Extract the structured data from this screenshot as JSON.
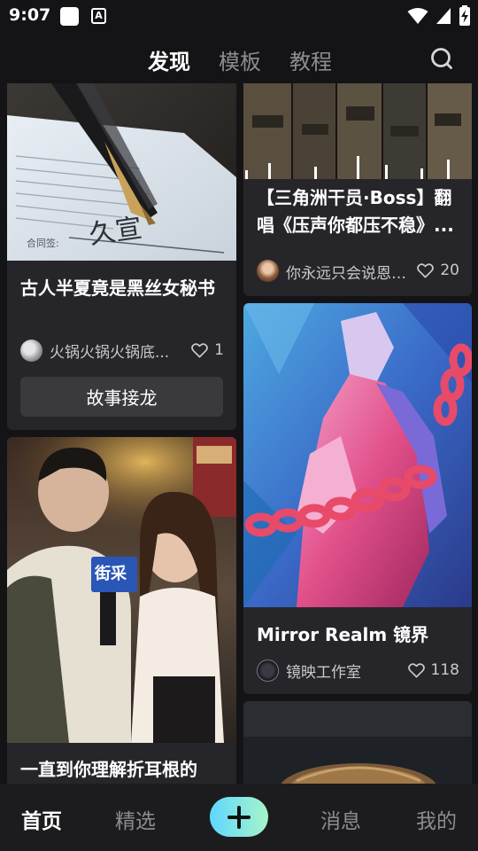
{
  "status_bar": {
    "time": "9:07",
    "a_icon_label": "A"
  },
  "top_tabs": [
    {
      "label": "发现",
      "active": true
    },
    {
      "label": "模板",
      "active": false
    },
    {
      "label": "教程",
      "active": false
    }
  ],
  "cards": {
    "left_1": {
      "title": "古人半夏竟是黑丝女秘书",
      "author": "火锅火锅火锅底...",
      "likes": "1",
      "action_label": "故事接龙",
      "image_text": "久宣",
      "image_caption": "合同签:"
    },
    "left_2": {
      "title": "一直到你理解折耳根的",
      "sign_text": "街采"
    },
    "right_1": {
      "title": "【三角洲干员·Boss】翻唱《压声你都压不稳》...",
      "author": "你永远只会说恩𓆝",
      "likes": "20"
    },
    "right_2": {
      "title": "Mirror Realm 镜界",
      "author": "镜映工作室",
      "likes": "118"
    },
    "right_3": {}
  },
  "bottom_nav": [
    {
      "label": "首页",
      "active": true
    },
    {
      "label": "精选",
      "active": false
    },
    {
      "label": "消息",
      "active": false
    },
    {
      "label": "我的",
      "active": false
    }
  ],
  "colors": {
    "background": "#141416",
    "card": "#26262a",
    "accent_gradient_start": "#5fd7ff",
    "accent_gradient_end": "#a6f4c9"
  }
}
